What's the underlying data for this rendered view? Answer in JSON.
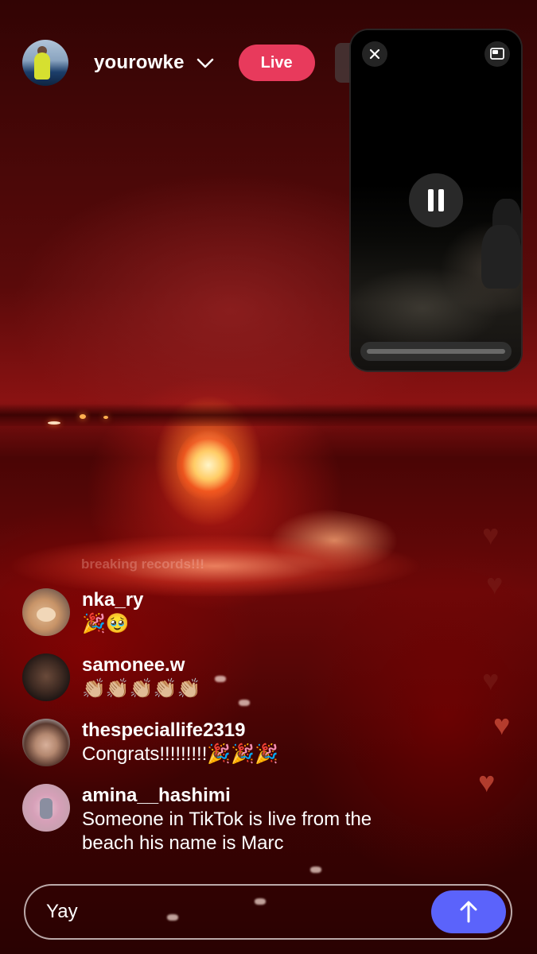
{
  "header": {
    "username": "yourowke",
    "live_label": "Live"
  },
  "video": {
    "overlay_text": "breaking records!!!"
  },
  "pip": {
    "close_icon": "close-icon",
    "restore_icon": "picture-in-picture-icon",
    "pause_icon": "pause-icon"
  },
  "comments": [
    {
      "username": "nka_ry",
      "text": "🎉🥹"
    },
    {
      "username": "samonee.w",
      "text": "👏🏼👏🏼👏🏼👏🏼👏🏼"
    },
    {
      "username": "thespeciallife2319",
      "text": "Congrats!!!!!!!!!🎉🎉🎉"
    },
    {
      "username": "amina__hashimi",
      "text": "Someone in TikTok is live from the beach his name is Marc"
    }
  ],
  "input": {
    "value": "Yay",
    "send_icon": "arrow-up-icon"
  },
  "colors": {
    "live_badge": "#e83a5c",
    "send_button": "#5b63fb"
  }
}
